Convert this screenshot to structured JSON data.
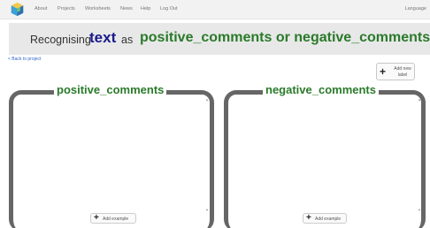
{
  "nav": {
    "items": [
      "About",
      "Projects",
      "Worksheets",
      "News",
      "Help",
      "Log Out"
    ],
    "language": "Language"
  },
  "banner": {
    "prefix": "Recognising",
    "type": "text",
    "middle": "as",
    "labels": "positive_comments or negative_comments"
  },
  "back_link": "< Back to project",
  "add_label": {
    "line1": "Add new",
    "line2": "label"
  },
  "panels": [
    {
      "title": "positive_comments",
      "button": "Add example"
    },
    {
      "title": "negative_comments",
      "button": "Add example"
    }
  ]
}
